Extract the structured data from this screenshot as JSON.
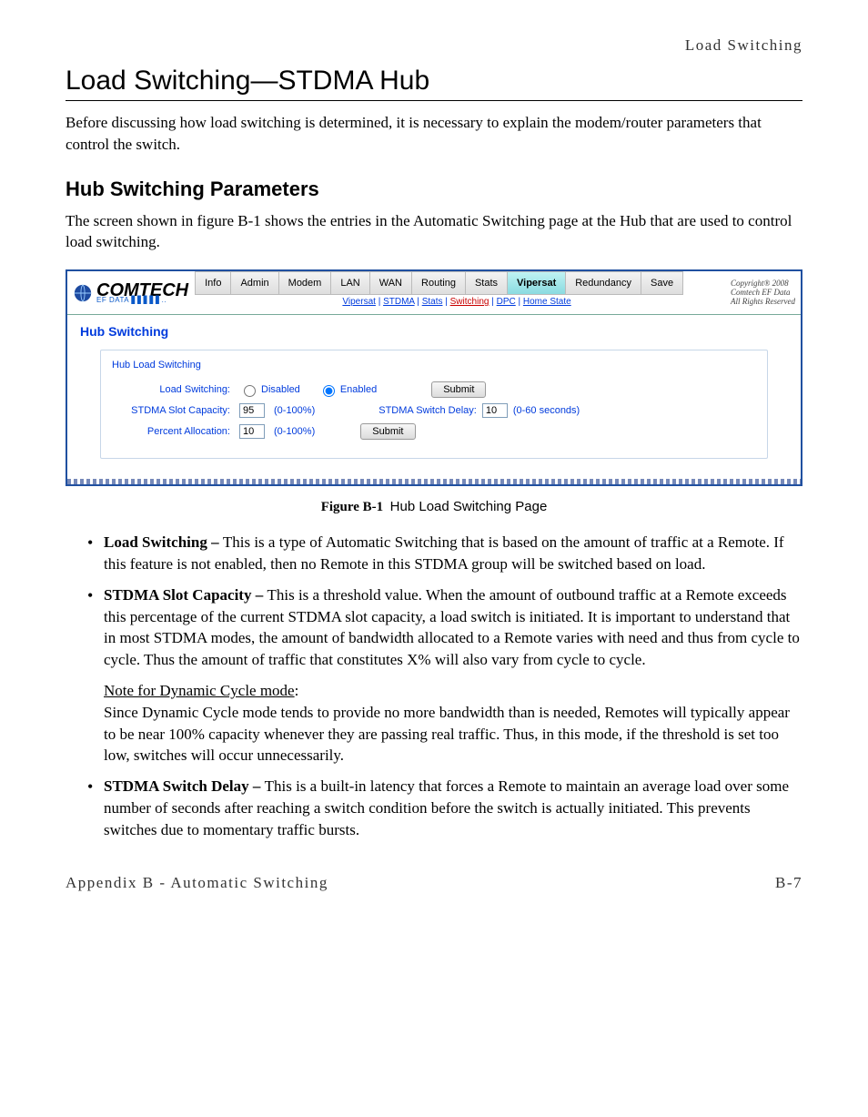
{
  "header": {
    "running_title": "Load Switching"
  },
  "title": "Load Switching—STDMA Hub",
  "intro": "Before discussing how load switching is determined, it is necessary to explain the modem/router parameters that control the switch.",
  "section_title": "Hub Switching Parameters",
  "section_intro": "The screen shown in figure B-1 shows the entries in the Automatic Switching page at the Hub that are used to control load switching.",
  "screenshot": {
    "logo_text": "COMTECH",
    "logo_subtext": "EF DATA ▋▋▋▋▋..",
    "tabs": [
      "Info",
      "Admin",
      "Modem",
      "LAN",
      "WAN",
      "Routing",
      "Stats",
      "Vipersat",
      "Redundancy",
      "Save"
    ],
    "active_tab": "Vipersat",
    "copyright": "Copyright® 2008\nComtech EF Data\nAll Rights Reserved",
    "subnav": [
      "Vipersat",
      "STDMA",
      "Stats",
      "Switching",
      "DPC",
      "Home State"
    ],
    "subnav_active": "Switching",
    "page_title": "Hub Switching",
    "fieldset_title": "Hub Load Switching",
    "fields": {
      "load_switching_label": "Load Switching:",
      "disabled_label": "Disabled",
      "enabled_label": "Enabled",
      "load_switching_value": "Enabled",
      "slot_capacity_label": "STDMA Slot Capacity:",
      "slot_capacity_value": "95",
      "slot_capacity_range": "(0-100%)",
      "percent_allocation_label": "Percent Allocation:",
      "percent_allocation_value": "10",
      "percent_allocation_range": "(0-100%)",
      "switch_delay_label": "STDMA Switch Delay:",
      "switch_delay_value": "10",
      "switch_delay_range": "(0-60 seconds)",
      "submit_label": "Submit"
    }
  },
  "caption_ref": "Figure B-1",
  "caption_name": "Hub Load Switching Page",
  "bullets": {
    "b1_term": "Load Switching – ",
    "b1_text": "This is a type of Automatic Switching that is based on the amount of traffic at a Remote. If this feature is not enabled, then no Remote in this STDMA group will be switched based on load.",
    "b2_term": "STDMA Slot Capacity – ",
    "b2_text": "This is a threshold value. When the amount of outbound traffic at a Remote exceeds this percentage of the current STDMA slot capacity, a load switch is initiated. It is important to understand that in most STDMA modes, the amount of bandwidth allocated to a Remote varies with need and thus from cycle to cycle. Thus the amount of traffic that constitutes X% will also vary from cycle to cycle.",
    "b2_subnote_title": "Note for Dynamic Cycle mode",
    "b2_subnote_colon": ":",
    "b2_subnote_body": "Since Dynamic Cycle mode tends to provide no more bandwidth than is needed, Remotes will typically appear to be near 100% capacity whenever they are passing real traffic. Thus, in this mode, if the threshold is set too low, switches will occur unnecessarily.",
    "b3_term": "STDMA Switch Delay – ",
    "b3_text": "This is a built-in latency that forces a Remote to maintain an average load over some number of seconds after reaching a switch condition before the switch is actually initiated. This prevents switches due to momentary traffic bursts."
  },
  "footer": {
    "left": "Appendix B - Automatic Switching",
    "right": "B-7"
  }
}
